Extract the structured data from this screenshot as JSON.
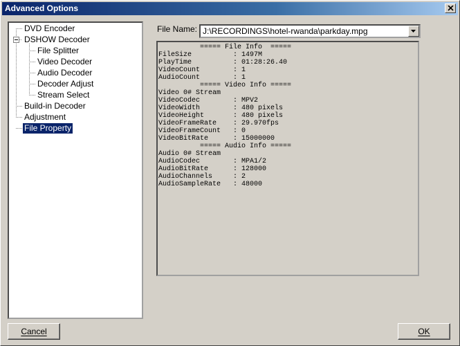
{
  "window": {
    "title": "Advanced Options"
  },
  "tree": {
    "items": [
      {
        "label": "DVD Encoder"
      },
      {
        "label": "DSHOW Decoder"
      },
      {
        "label": "File Splitter"
      },
      {
        "label": "Video Decoder"
      },
      {
        "label": "Audio Decoder"
      },
      {
        "label": "Decoder Adjust"
      },
      {
        "label": "Stream Select"
      },
      {
        "label": "Build-in Decoder"
      },
      {
        "label": "Adjustment"
      },
      {
        "label": "File Property",
        "selected": true
      }
    ]
  },
  "file": {
    "label": "File Name:",
    "value": "J:\\RECORDINGS\\hotel-rwanda\\parkday.mpg"
  },
  "info": {
    "lines": [
      "          ===== File Info  =====",
      "FileSize          : 1497M",
      "PlayTime          : 01:28:26.40",
      "VideoCount        : 1",
      "AudioCount        : 1",
      "          ===== Video Info =====",
      "Video 0# Stream",
      "VideoCodec        : MPV2",
      "VideoWidth        : 480 pixels",
      "VideoHeight       : 480 pixels",
      "VideoFrameRate    : 29.970fps",
      "VideoFrameCount   : 0",
      "VideoBitRate      : 15000000",
      "          ===== Audio Info =====",
      "Audio 0# Stream",
      "AudioCodec        : MPA1/2",
      "AudioBitRate      : 128000",
      "AudioChannels     : 2",
      "AudioSampleRate   : 48000"
    ]
  },
  "buttons": {
    "cancel": "Cancel",
    "ok": "OK"
  }
}
